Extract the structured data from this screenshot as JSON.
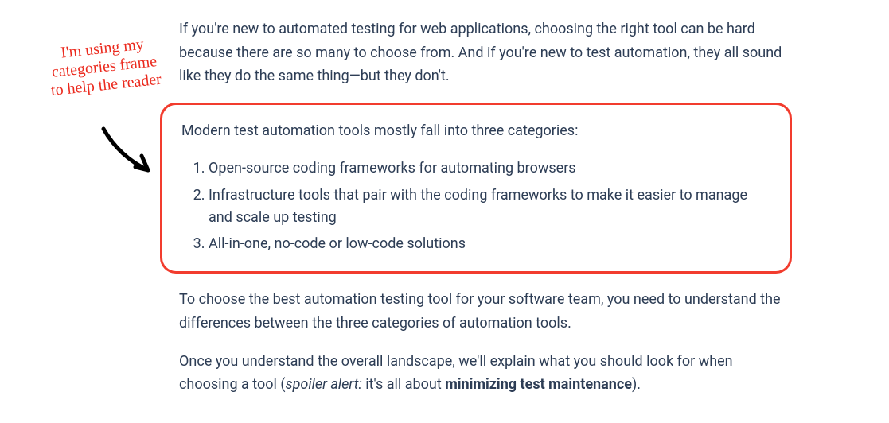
{
  "annotation": {
    "line1": "I'm using my",
    "line2": "categories frame",
    "line3": "to help the reader"
  },
  "paragraphs": {
    "intro": "If you're new to automated testing for web applications, choosing the right tool can be hard because there are so many to choose from. And if you're new to test automation, they all sound like they do the same thing—but they don't.",
    "callout_intro": "Modern test automation tools mostly fall into three categories:",
    "categories": [
      "Open-source coding frameworks for automating browsers",
      "Infrastructure tools that pair with the coding frameworks to make it easier to manage and scale up testing",
      "All-in-one, no-code or low-code solutions"
    ],
    "after_callout": "To choose the best automation testing tool for your software team, you need to understand the differences between the three categories of automation tools.",
    "closing_pre": "Once you understand the overall landscape, we'll explain what you should look for when choosing a tool (",
    "closing_spoiler": "spoiler alert:",
    "closing_mid": " it's all about ",
    "closing_bold": "minimizing test maintenance",
    "closing_end": ")."
  },
  "colors": {
    "text": "#2d3d55",
    "highlight_border": "#f23c2e",
    "annotation": "#eb2a1e"
  }
}
